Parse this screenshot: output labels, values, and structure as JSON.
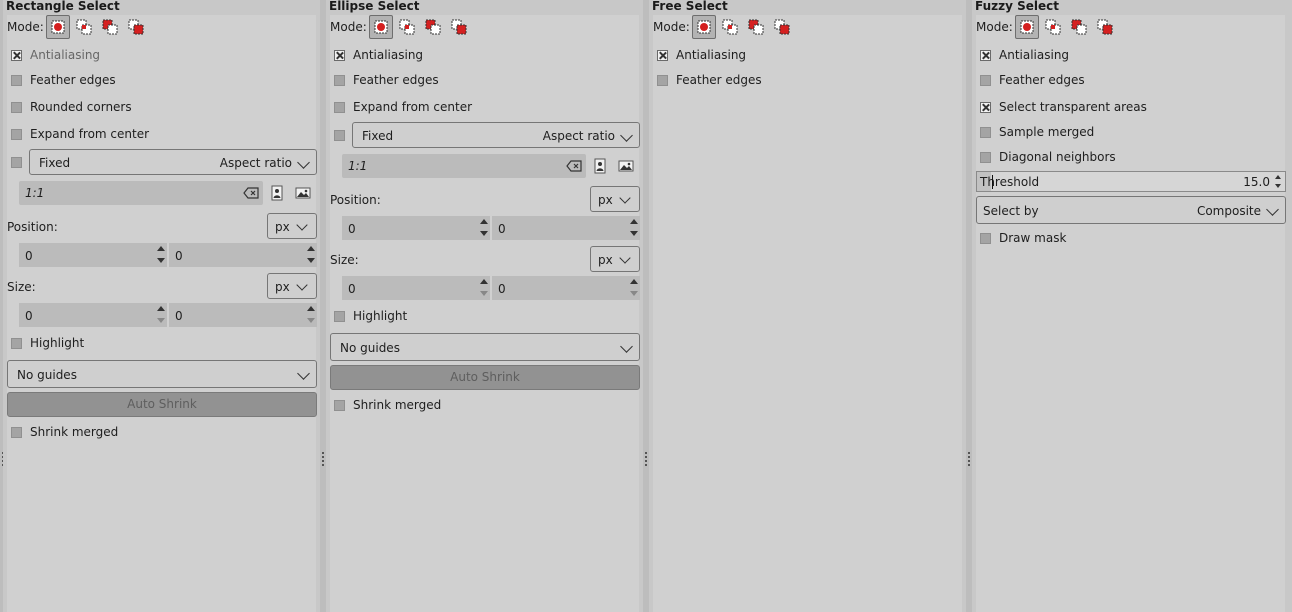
{
  "mode_label": "Mode:",
  "rect": {
    "title": "Rectangle Select",
    "antialiasing": "Antialiasing",
    "feather": "Feather edges",
    "rounded": "Rounded corners",
    "expand": "Expand from center",
    "fixed": "Fixed",
    "aspect": "Aspect ratio",
    "ratio": "1:1",
    "position_label": "Position:",
    "position_unit": "px",
    "pos_x": "0",
    "pos_y": "0",
    "size_label": "Size:",
    "size_unit": "px",
    "size_w": "0",
    "size_h": "0",
    "highlight": "Highlight",
    "guides": "No guides",
    "auto_shrink": "Auto Shrink",
    "shrink_merged": "Shrink merged"
  },
  "ellipse": {
    "title": "Ellipse Select",
    "antialiasing": "Antialiasing",
    "feather": "Feather edges",
    "expand": "Expand from center",
    "fixed": "Fixed",
    "aspect": "Aspect ratio",
    "ratio": "1:1",
    "position_label": "Position:",
    "position_unit": "px",
    "pos_x": "0",
    "pos_y": "0",
    "size_label": "Size:",
    "size_unit": "px",
    "size_w": "0",
    "size_h": "0",
    "highlight": "Highlight",
    "guides": "No guides",
    "auto_shrink": "Auto Shrink",
    "shrink_merged": "Shrink merged"
  },
  "free": {
    "title": "Free Select",
    "antialiasing": "Antialiasing",
    "feather": "Feather edges"
  },
  "fuzzy": {
    "title": "Fuzzy Select",
    "antialiasing": "Antialiasing",
    "feather": "Feather edges",
    "transparent": "Select transparent areas",
    "sample_merged": "Sample merged",
    "diagonal": "Diagonal neighbors",
    "threshold_label": "Threshold",
    "threshold_value": "15.0",
    "select_by_label": "Select by",
    "select_by_value": "Composite",
    "draw_mask": "Draw mask"
  },
  "colors": {
    "panel": "#d0d0d0",
    "mode_red": "#d42020"
  }
}
